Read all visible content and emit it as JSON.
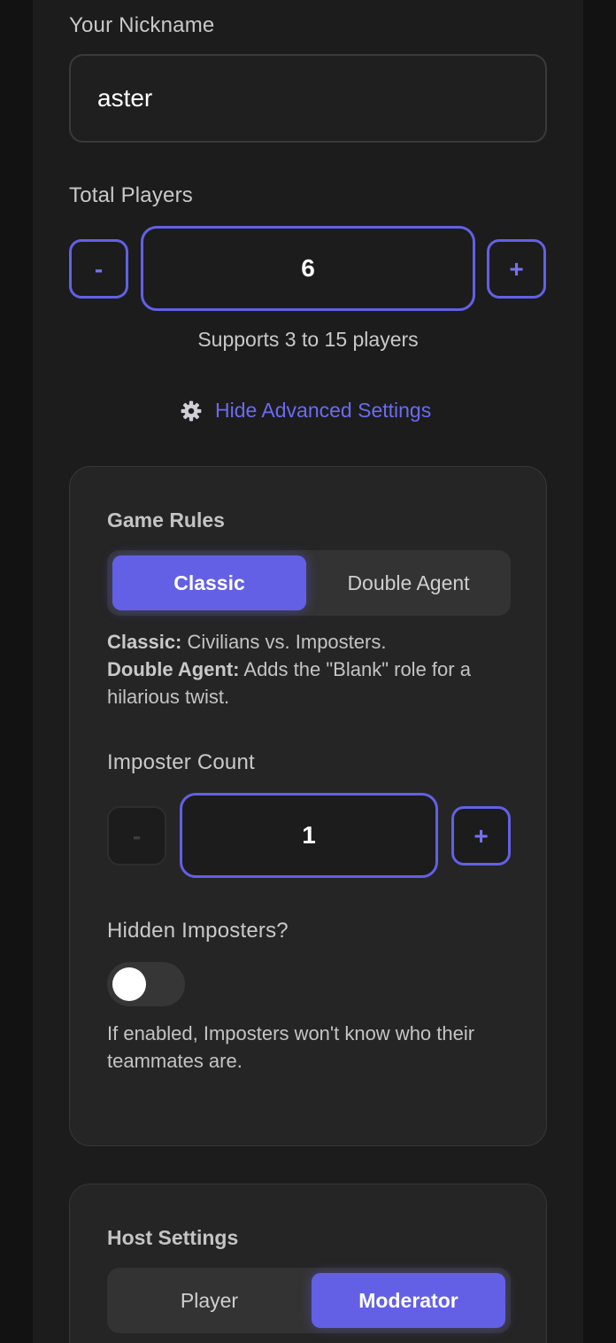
{
  "nickname": {
    "label": "Your Nickname",
    "value": "aster"
  },
  "players": {
    "label": "Total Players",
    "minus": "-",
    "value": "6",
    "plus": "+",
    "hint": "Supports 3 to 15 players"
  },
  "advanced_link": {
    "icon": "gear-icon",
    "label": "Hide Advanced Settings"
  },
  "game_rules": {
    "title": "Game Rules",
    "options": [
      "Classic",
      "Double Agent"
    ],
    "selected": "Classic",
    "desc_classic_bold": "Classic:",
    "desc_classic_text": " Civilians vs. Imposters.",
    "desc_double_bold": "Double Agent:",
    "desc_double_text": " Adds the \"Blank\" role for a hilarious twist."
  },
  "imposter_count": {
    "label": "Imposter Count",
    "minus": "-",
    "value": "1",
    "plus": "+"
  },
  "hidden_imposters": {
    "label": "Hidden Imposters?",
    "enabled": false,
    "hint": "If enabled, Imposters won't know who their teammates are."
  },
  "host_settings": {
    "title": "Host Settings",
    "options": [
      "Player",
      "Moderator"
    ],
    "selected": "Moderator"
  },
  "colors": {
    "accent": "#6360e6",
    "background": "#121212",
    "card": "#252525"
  }
}
